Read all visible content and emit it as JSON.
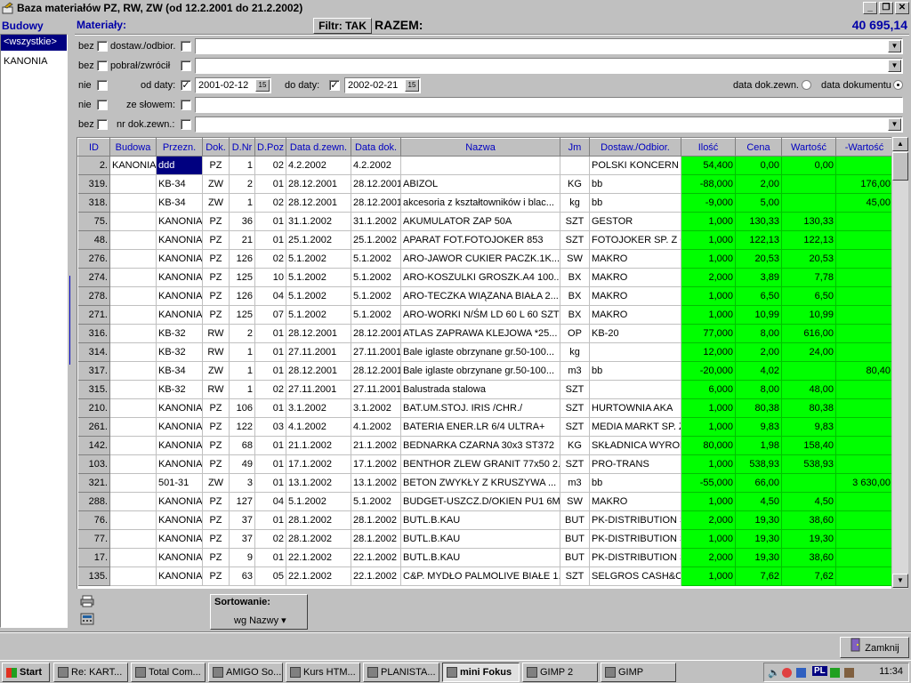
{
  "window": {
    "title": "Baza materiałów PZ, RW, ZW (od 12.2.2001 do 21.2.2002)"
  },
  "sidebar": {
    "header": "Budowy",
    "items": [
      {
        "label": "<wszystkie>",
        "selected": true
      },
      {
        "label": "KANONIA",
        "selected": false
      }
    ]
  },
  "header": {
    "materials_label": "Materiały:",
    "filter_label": "Filtr: TAK",
    "total_label": "RAZEM:",
    "total_value": "40 695,14"
  },
  "filters": {
    "row1": {
      "bez": "bez",
      "label": "dostaw./odbior.",
      "value": ""
    },
    "row2": {
      "bez": "bez",
      "label": "pobrał/zwrócił",
      "value": ""
    },
    "row3": {
      "nie": "nie",
      "od_label": "od daty:",
      "od_value": "2001-02-12",
      "od_checked": true,
      "do_label": "do daty:",
      "do_value": "2002-02-21",
      "do_checked": true,
      "radio1": "data dok.zewn.",
      "radio2": "data dokumentu"
    },
    "row4": {
      "nie": "nie",
      "label": "ze słowem:",
      "value": ""
    },
    "row5": {
      "bez": "bez",
      "label": "nr dok.zewn.:",
      "value": ""
    }
  },
  "table": {
    "columns": [
      "ID",
      "Budowa",
      "Przezn.",
      "Dok.",
      "D.Nr",
      "D.Poz",
      "Data d.zewn.",
      "Data dok.",
      "Nazwa",
      "Jm",
      "Dostaw./Odbior.",
      "Ilość",
      "Cena",
      "Wartość",
      "-Wartość"
    ],
    "rows": [
      [
        "2.",
        "KANONIA",
        "ddd",
        "PZ",
        "1",
        "02",
        "4.2.2002",
        "4.2.2002",
        "",
        "",
        "POLSKI KONCERN N.",
        "54,400",
        "0,00",
        "0,00",
        ""
      ],
      [
        "319.",
        "",
        "KB-34",
        "ZW",
        "2",
        "01",
        "28.12.2001",
        "28.12.2001",
        "ABIZOL",
        "KG",
        "bb",
        "-88,000",
        "2,00",
        "",
        "176,00"
      ],
      [
        "318.",
        "",
        "KB-34",
        "ZW",
        "1",
        "02",
        "28.12.2001",
        "28.12.2001",
        "akcesoria z kształtowników i blac...",
        "kg",
        "bb",
        "-9,000",
        "5,00",
        "",
        "45,00"
      ],
      [
        "75.",
        "",
        "KANONIA",
        "PZ",
        "36",
        "01",
        "31.1.2002",
        "31.1.2002",
        "AKUMULATOR ZAP 50A",
        "SZT",
        "GESTOR",
        "1,000",
        "130,33",
        "130,33",
        ""
      ],
      [
        "48.",
        "",
        "KANONIA",
        "PZ",
        "21",
        "01",
        "25.1.2002",
        "25.1.2002",
        "APARAT FOT.FOTOJOKER 853",
        "SZT",
        "FOTOJOKER SP. Z C",
        "1,000",
        "122,13",
        "122,13",
        ""
      ],
      [
        "276.",
        "",
        "KANONIA",
        "PZ",
        "126",
        "02",
        "5.1.2002",
        "5.1.2002",
        "ARO-JAWOR CUKIER PACZK.1K...",
        "SW",
        "MAKRO",
        "1,000",
        "20,53",
        "20,53",
        ""
      ],
      [
        "274.",
        "",
        "KANONIA",
        "PZ",
        "125",
        "10",
        "5.1.2002",
        "5.1.2002",
        "ARO-KOSZULKI GROSZK.A4 100...",
        "BX",
        "MAKRO",
        "2,000",
        "3,89",
        "7,78",
        ""
      ],
      [
        "278.",
        "",
        "KANONIA",
        "PZ",
        "126",
        "04",
        "5.1.2002",
        "5.1.2002",
        "ARO-TECZKA WIĄZANA BIAŁA 2...",
        "BX",
        "MAKRO",
        "1,000",
        "6,50",
        "6,50",
        ""
      ],
      [
        "271.",
        "",
        "KANONIA",
        "PZ",
        "125",
        "07",
        "5.1.2002",
        "5.1.2002",
        "ARO-WORKI N/ŚM LD 60 L 60 SZT",
        "BX",
        "MAKRO",
        "1,000",
        "10,99",
        "10,99",
        ""
      ],
      [
        "316.",
        "",
        "KB-32",
        "RW",
        "2",
        "01",
        "28.12.2001",
        "28.12.2001",
        "ATLAS ZAPRAWA KLEJOWA *25...",
        "OP",
        "KB-20",
        "77,000",
        "8,00",
        "616,00",
        ""
      ],
      [
        "314.",
        "",
        "KB-32",
        "RW",
        "1",
        "01",
        "27.11.2001",
        "27.11.2001",
        "Bale iglaste obrzynane gr.50-100...",
        "kg",
        "",
        "12,000",
        "2,00",
        "24,00",
        ""
      ],
      [
        "317.",
        "",
        "KB-34",
        "ZW",
        "1",
        "01",
        "28.12.2001",
        "28.12.2001",
        "Bale iglaste obrzynane gr.50-100...",
        "m3",
        "bb",
        "-20,000",
        "4,02",
        "",
        "80,40"
      ],
      [
        "315.",
        "",
        "KB-32",
        "RW",
        "1",
        "02",
        "27.11.2001",
        "27.11.2001",
        "Balustrada stalowa",
        "SZT",
        "",
        "6,000",
        "8,00",
        "48,00",
        ""
      ],
      [
        "210.",
        "",
        "KANONIA",
        "PZ",
        "106",
        "01",
        "3.1.2002",
        "3.1.2002",
        "BAT.UM.STOJ. IRIS /CHR./",
        "SZT",
        "HURTOWNIA AKA",
        "1,000",
        "80,38",
        "80,38",
        ""
      ],
      [
        "261.",
        "",
        "KANONIA",
        "PZ",
        "122",
        "03",
        "4.1.2002",
        "4.1.2002",
        "BATERIA ENER.LR 6/4 ULTRA+",
        "SZT",
        "MEDIA MARKT SP. Z",
        "1,000",
        "9,83",
        "9,83",
        ""
      ],
      [
        "142.",
        "",
        "KANONIA",
        "PZ",
        "68",
        "01",
        "21.1.2002",
        "21.1.2002",
        "BEDNARKA CZARNA 30x3 ST372",
        "KG",
        "SKŁADNICA WYROE",
        "80,000",
        "1,98",
        "158,40",
        ""
      ],
      [
        "103.",
        "",
        "KANONIA",
        "PZ",
        "49",
        "01",
        "17.1.2002",
        "17.1.2002",
        "BENTHOR ZLEW GRANIT 77x50 2...",
        "SZT",
        "PRO-TRANS",
        "1,000",
        "538,93",
        "538,93",
        ""
      ],
      [
        "321.",
        "",
        "501-31",
        "ZW",
        "3",
        "01",
        "13.1.2002",
        "13.1.2002",
        "BETON ZWYKŁY Z KRUSZYWA ...",
        "m3",
        "bb",
        "-55,000",
        "66,00",
        "",
        "3 630,00"
      ],
      [
        "288.",
        "",
        "KANONIA",
        "PZ",
        "127",
        "04",
        "5.1.2002",
        "5.1.2002",
        "BUDGET-USZCZ.D/OKIEN PU1 6M...",
        "SW",
        "MAKRO",
        "1,000",
        "4,50",
        "4,50",
        ""
      ],
      [
        "76.",
        "",
        "KANONIA",
        "PZ",
        "37",
        "01",
        "28.1.2002",
        "28.1.2002",
        "BUTL.B.KAU",
        "BUT",
        "PK-DISTRIBUTION SF",
        "2,000",
        "19,30",
        "38,60",
        ""
      ],
      [
        "77.",
        "",
        "KANONIA",
        "PZ",
        "37",
        "02",
        "28.1.2002",
        "28.1.2002",
        "BUTL.B.KAU",
        "BUT",
        "PK-DISTRIBUTION SF",
        "1,000",
        "19,30",
        "19,30",
        ""
      ],
      [
        "17.",
        "",
        "KANONIA",
        "PZ",
        "9",
        "01",
        "22.1.2002",
        "22.1.2002",
        "BUTL.B.KAU",
        "BUT",
        "PK-DISTRIBUTION SF",
        "2,000",
        "19,30",
        "38,60",
        ""
      ],
      [
        "135.",
        "",
        "KANONIA",
        "PZ",
        "63",
        "05",
        "22.1.2002",
        "22.1.2002",
        "C&P. MYDŁO PALMOLIVE BIAŁE 1...",
        "SZT",
        "SELGROS CASH&CA",
        "1,000",
        "7,62",
        "7,62",
        ""
      ]
    ]
  },
  "footer": {
    "sort_label": "Sortowanie:",
    "sort_value": "wg Nazwy",
    "close_label": "Zamknij"
  },
  "taskbar": {
    "start": "Start",
    "items": [
      "Re: KART...",
      "Total Com...",
      "AMIGO So...",
      "Kurs HTM...",
      "PLANISTA...",
      "mini Fokus",
      "GIMP 2",
      "GIMP"
    ],
    "active_index": 5,
    "lang": "PL",
    "clock": "11:34"
  },
  "colors": {
    "grid_green": "#00ff00",
    "selection": "#000080",
    "header_text": "#0000c0"
  }
}
